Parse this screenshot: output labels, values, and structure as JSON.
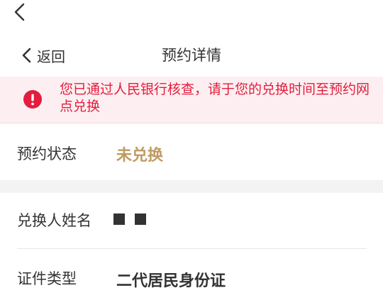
{
  "outer_back": {
    "icon": "chevron-left-icon"
  },
  "nav": {
    "back_label": "返回",
    "title": "预约详情"
  },
  "alert": {
    "icon": "exclamation-circle-icon",
    "color": "#e41c3e",
    "background": "#fdeff1",
    "message": "您已通过人民银行核查，请于您的兑换时间至预约网点兑换"
  },
  "details": {
    "status": {
      "label": "预约状态",
      "value": "未兑换",
      "color": "#bf9a62"
    },
    "name": {
      "label": "兑换人姓名",
      "value_masked": true
    },
    "id_type": {
      "label": "证件类型",
      "value": "二代居民身份证"
    }
  }
}
